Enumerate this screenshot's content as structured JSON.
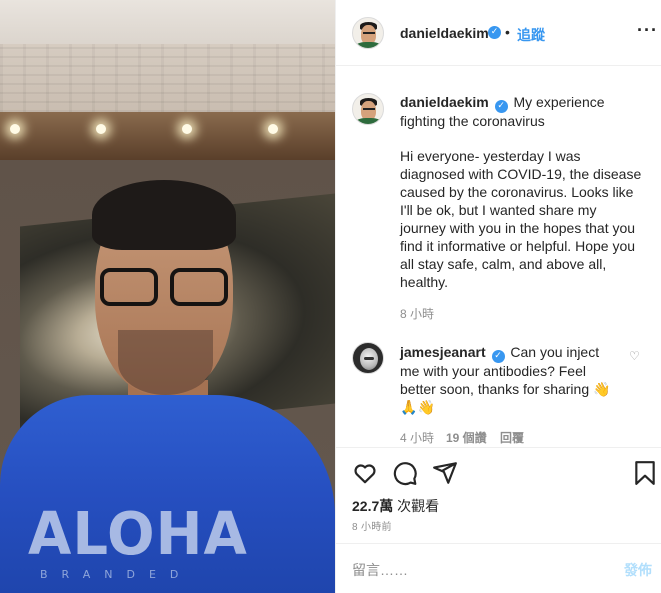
{
  "post": {
    "username": "danieldaekim",
    "follow_label": "追蹤",
    "separator": "•",
    "more_icon": "more-horizontal-icon",
    "caption_title": "My experience fighting the coronavirus",
    "caption_body": "Hi everyone- yesterday I was diagnosed with COVID-19, the disease caused by the coronavirus. Looks like I'll be ok, but I wanted share my journey with you in the hopes that you find it informative or helpful. Hope you all stay safe, calm, and above all, healthy.",
    "caption_time": "8 小時"
  },
  "comment": {
    "username": "jamesjeanart",
    "text": "Can you inject me with your antibodies? Feel better soon, thanks for sharing",
    "time": "4 小時",
    "likes": "19 個讚",
    "reply_label": "回覆"
  },
  "video": {
    "shirt_text": "ALOHA",
    "shirt_sub": "BRANDED"
  },
  "stats": {
    "views": "22.7萬",
    "views_label": "次觀看",
    "posted": "8 小時前"
  },
  "comment_box": {
    "placeholder": "留言……",
    "post_label": "發佈"
  },
  "colors": {
    "accent": "#3897f0",
    "post_disabled": "#b2dffc",
    "muted": "#8e8e8e"
  }
}
